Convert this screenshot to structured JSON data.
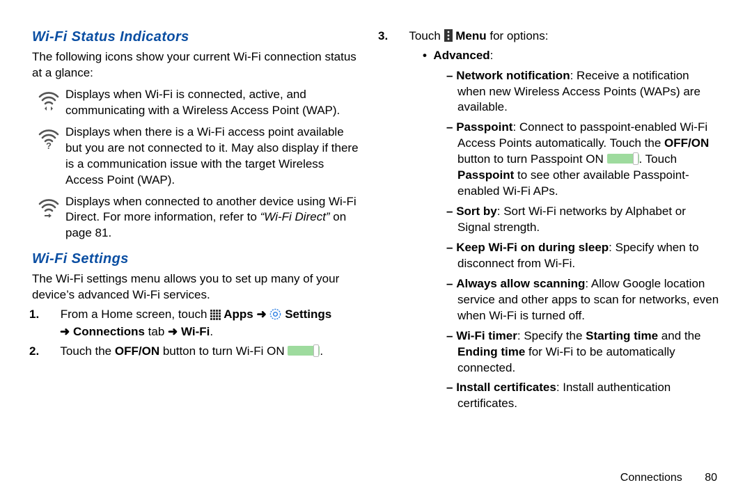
{
  "leftCol": {
    "heading1": "Wi-Fi Status Indicators",
    "intro1": "The following icons show your current Wi-Fi connection status at a glance:",
    "indicator1": "Displays when Wi-Fi is connected, active, and communicating with a Wireless Access Point (WAP).",
    "indicator2": "Displays when there is a Wi-Fi access point available but you are not connected to it. May also display if there is a communication issue with the target Wireless Access Point (WAP).",
    "indicator3a": "Displays when connected to another device using Wi-Fi Direct. For more information, refer to ",
    "indicator3b": "“Wi-Fi Direct”",
    "indicator3c": " on page 81.",
    "heading2": "Wi-Fi Settings",
    "intro2": "The Wi-Fi settings menu allows you to set up many of your device’s advanced Wi-Fi services.",
    "step1": {
      "num": "1.",
      "textA": "From a Home screen, touch ",
      "apps": " Apps",
      "settings": " Settings",
      "connections": "Connections",
      "tab": " tab ",
      "wifi": "Wi-Fi",
      "period": "."
    },
    "step2": {
      "num": "2.",
      "textA": "Touch the ",
      "offon": "OFF/ON",
      "textB": " button to turn Wi-Fi ON ",
      "period": "."
    }
  },
  "rightCol": {
    "step3": {
      "num": "3.",
      "textA": "Touch ",
      "menu": " Menu",
      "textB": " for options:"
    },
    "advanced": "Advanced",
    "items": {
      "netNotif": {
        "label": "Network notification",
        "text": ": Receive a notification when new Wireless Access Points (WAPs) are available."
      },
      "passpoint": {
        "label": "Passpoint",
        "a": ": Connect to passpoint-enabled Wi-Fi Access Points automatically. Touch the ",
        "offon": "OFF/ON",
        "b": " button to turn Passpoint ON ",
        "c": ". Touch ",
        "pp2": "Passpoint",
        "d": " to see other available Passpoint-enabled Wi-Fi APs."
      },
      "sortBy": {
        "label": "Sort by",
        "text": ": Sort Wi-Fi networks by Alphabet or Signal strength."
      },
      "keepOn": {
        "label": "Keep Wi-Fi on during sleep",
        "text": ": Specify when to disconnect from Wi-Fi."
      },
      "allowScan": {
        "label": "Always allow scanning",
        "text": ": Allow Google location service and other apps to scan for networks, even when Wi-Fi is turned off."
      },
      "timer": {
        "label": "Wi-Fi timer",
        "a": ": Specify the ",
        "start": "Starting time",
        "b": " and the ",
        "end": "Ending time",
        "c": " for Wi-Fi to be automatically connected."
      },
      "certs": {
        "label": "Install certificates",
        "text": ": Install authentication certificates."
      }
    }
  },
  "footer": {
    "section": "Connections",
    "page": "80"
  },
  "glyphs": {
    "arrow": "➜",
    "colon": ":"
  }
}
